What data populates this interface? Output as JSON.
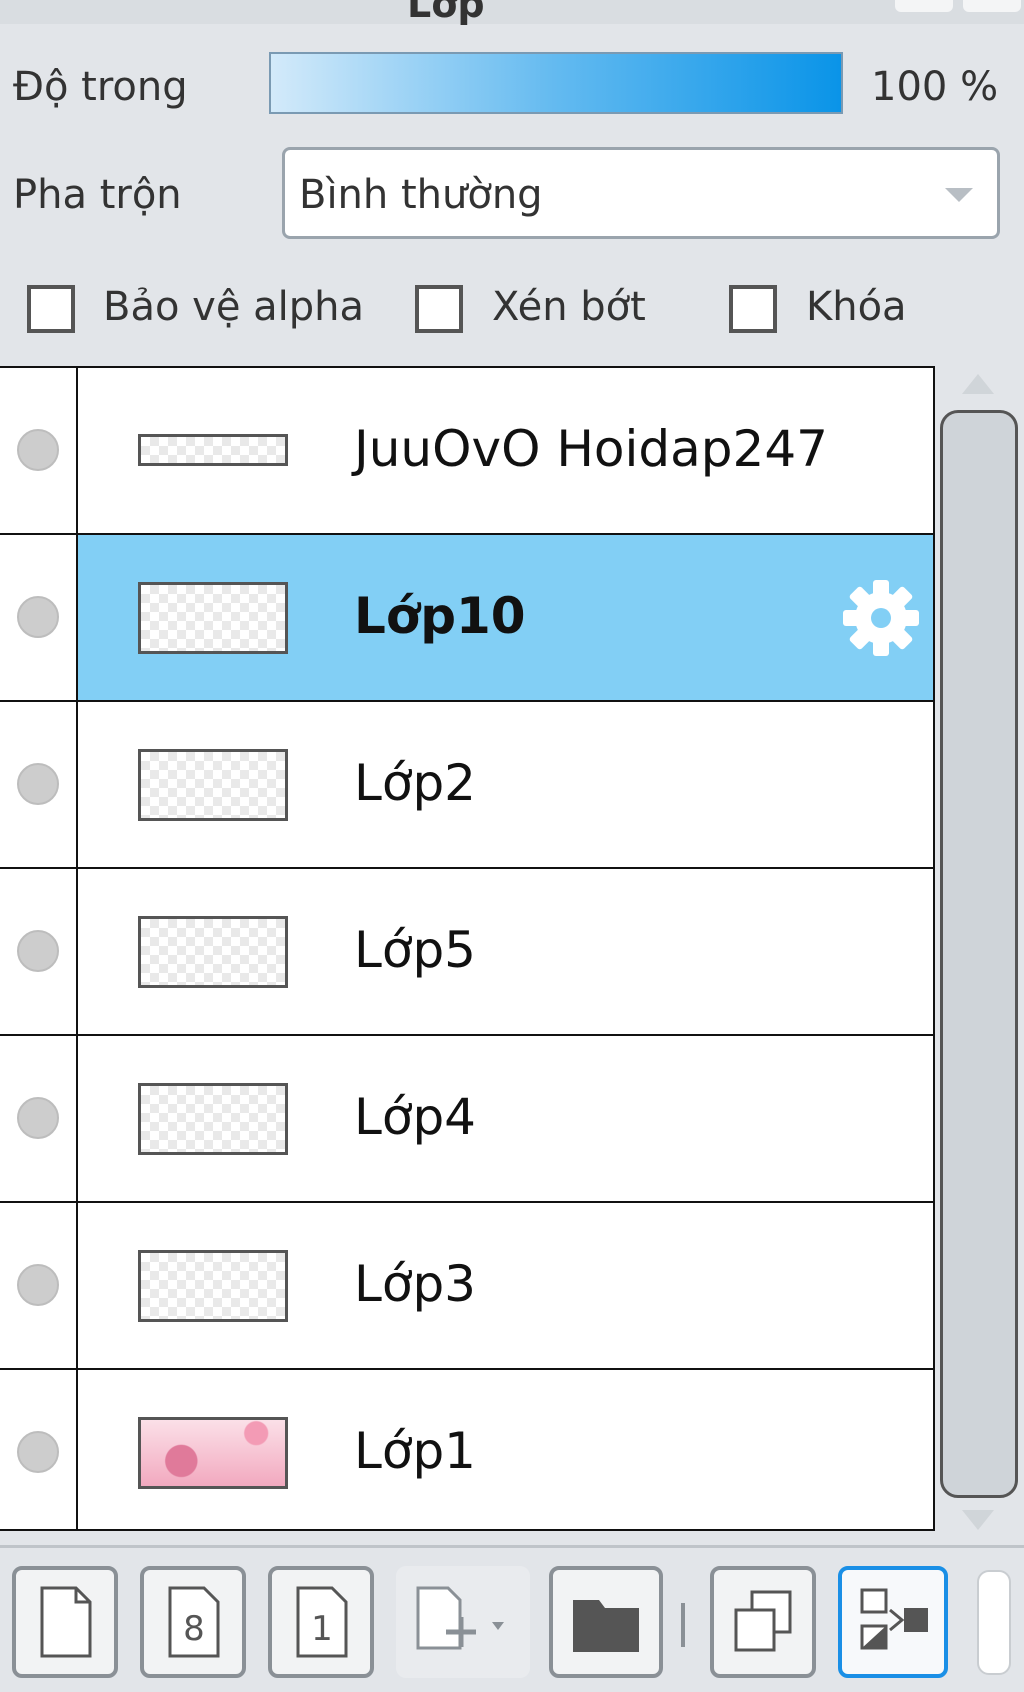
{
  "panel": {
    "title": "Lớp"
  },
  "opacity": {
    "label": "Độ trong",
    "value": "100 %"
  },
  "blend": {
    "label": "Pha trộn",
    "value": "Bình thường"
  },
  "options": {
    "protect_alpha": "Bảo vệ alpha",
    "clip": "Xén bớt",
    "lock": "Khóa"
  },
  "layers": [
    {
      "name": "JuuOvO Hoidap247",
      "selected": false
    },
    {
      "name": "Lớp10",
      "selected": true
    },
    {
      "name": "Lớp2",
      "selected": false
    },
    {
      "name": "Lớp5",
      "selected": false
    },
    {
      "name": "Lớp4",
      "selected": false
    },
    {
      "name": "Lớp3",
      "selected": false
    },
    {
      "name": "Lớp1",
      "selected": false
    }
  ],
  "toolbar": {
    "icons": [
      "new-layer-icon",
      "new-layer-8bit-icon",
      "new-layer-1bit-icon",
      "add-layer-dropdown-icon",
      "new-folder-icon",
      "duplicate-layer-icon",
      "transfer-layer-icon"
    ]
  },
  "colors": {
    "accent": "#82cff5",
    "active_border": "#1a8fe6"
  }
}
